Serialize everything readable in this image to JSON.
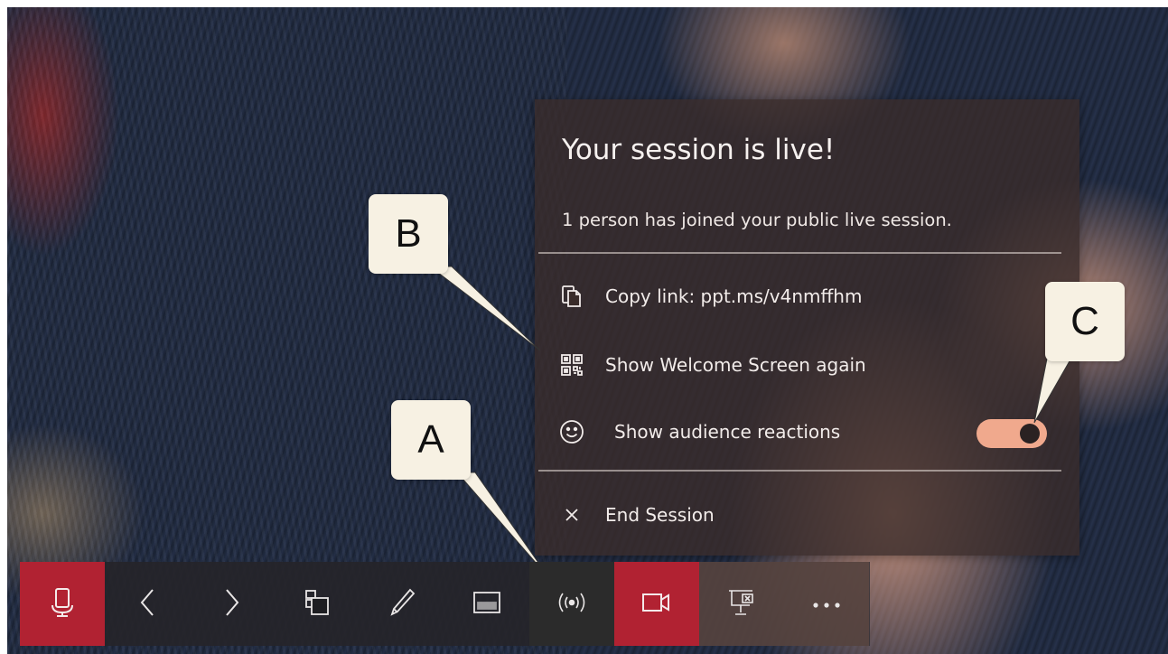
{
  "panel": {
    "title": "Your session is live!",
    "subtitle": "1 person has joined your public live session.",
    "items": [
      {
        "label": "Copy link: ppt.ms/v4nmffhm",
        "icon": "copy-icon"
      },
      {
        "label": "Show Welcome Screen again",
        "icon": "qr-code-icon"
      },
      {
        "label": "Show audience reactions",
        "icon": "smiley-icon",
        "toggle_on": true
      },
      {
        "label": "End Session",
        "icon": "close-icon"
      }
    ]
  },
  "callouts": {
    "a": "A",
    "b": "B",
    "c": "C"
  },
  "toolbar": {
    "buttons": [
      {
        "name": "microphone",
        "icon": "microphone-icon",
        "active": true
      },
      {
        "name": "previous",
        "icon": "chevron-left-icon"
      },
      {
        "name": "next",
        "icon": "chevron-right-icon"
      },
      {
        "name": "slide-view",
        "icon": "slides-icon"
      },
      {
        "name": "pen",
        "icon": "pen-icon"
      },
      {
        "name": "subtitles",
        "icon": "subtitles-icon"
      },
      {
        "name": "live-session",
        "icon": "broadcast-icon",
        "selected": true
      },
      {
        "name": "camera",
        "icon": "camera-icon",
        "active": true
      },
      {
        "name": "end-show",
        "icon": "end-show-icon"
      },
      {
        "name": "more",
        "icon": "more-icon"
      }
    ]
  },
  "colors": {
    "accent_red": "#b12232",
    "toggle_on": "#f0a98d",
    "panel_bg": "#3a2c2a"
  }
}
